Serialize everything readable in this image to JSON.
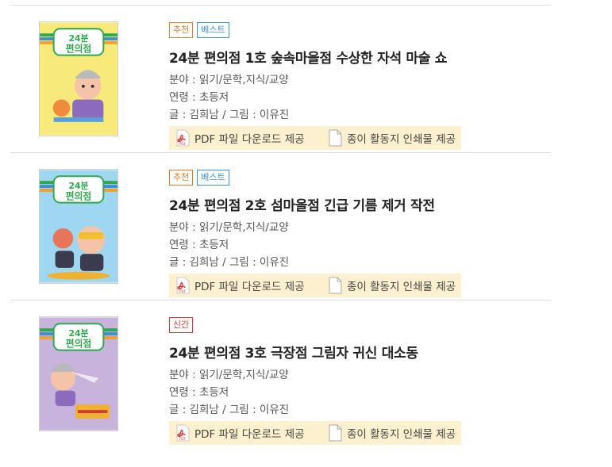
{
  "colors": {
    "recommend": "#e07a2c",
    "best": "#3d8fd4",
    "new": "#d33a3a",
    "download_bg": "#fdf0cf",
    "pdf_red": "#e03d3d"
  },
  "books": [
    {
      "badges": [
        {
          "label": "추천",
          "color": "#e07a2c"
        },
        {
          "label": "베스트",
          "color": "#3d8fd4"
        }
      ],
      "title": "24분 편의점 1호 숲속마을점 수상한 자석 마술 쇼",
      "field": "분야 : 읽기/문학,지식/교양",
      "age": "연령 : 초등저",
      "author": "글 : 김희남 / 그림 : 이유진",
      "pdf_label": "PDF 파일 다운로드 제공",
      "paper_label": "종이 활동지 인쇄물 제공",
      "cover": {
        "series": "24분",
        "name": "편의점",
        "bg": "#f8ea7a",
        "icon": "book-cover-1"
      }
    },
    {
      "badges": [
        {
          "label": "추천",
          "color": "#e07a2c"
        },
        {
          "label": "베스트",
          "color": "#3d8fd4"
        }
      ],
      "title": "24분 편의점 2호 섬마을점 긴급 기름 제거 작전",
      "field": "분야 : 읽기/문학,지식/교양",
      "age": "연령 : 초등저",
      "author": "글 : 김희남 / 그림 : 이유진",
      "pdf_label": "PDF 파일 다운로드 제공",
      "paper_label": "종이 활동지 인쇄물 제공",
      "cover": {
        "series": "24분",
        "name": "편의점",
        "bg": "#9fd7f0",
        "icon": "book-cover-2"
      }
    },
    {
      "badges": [
        {
          "label": "신간",
          "color": "#d33a3a"
        }
      ],
      "title": "24분 편의점 3호 극장점 그림자 귀신 대소동",
      "field": "분야 : 읽기/문학,지식/교양",
      "age": "연령 : 초등저",
      "author": "글 : 김희남 / 그림 : 이유진",
      "pdf_label": "PDF 파일 다운로드 제공",
      "paper_label": "종이 활동지 인쇄물 제공",
      "cover": {
        "series": "24분",
        "name": "편의점",
        "bg": "#c7b3dc",
        "icon": "book-cover-3"
      }
    }
  ]
}
